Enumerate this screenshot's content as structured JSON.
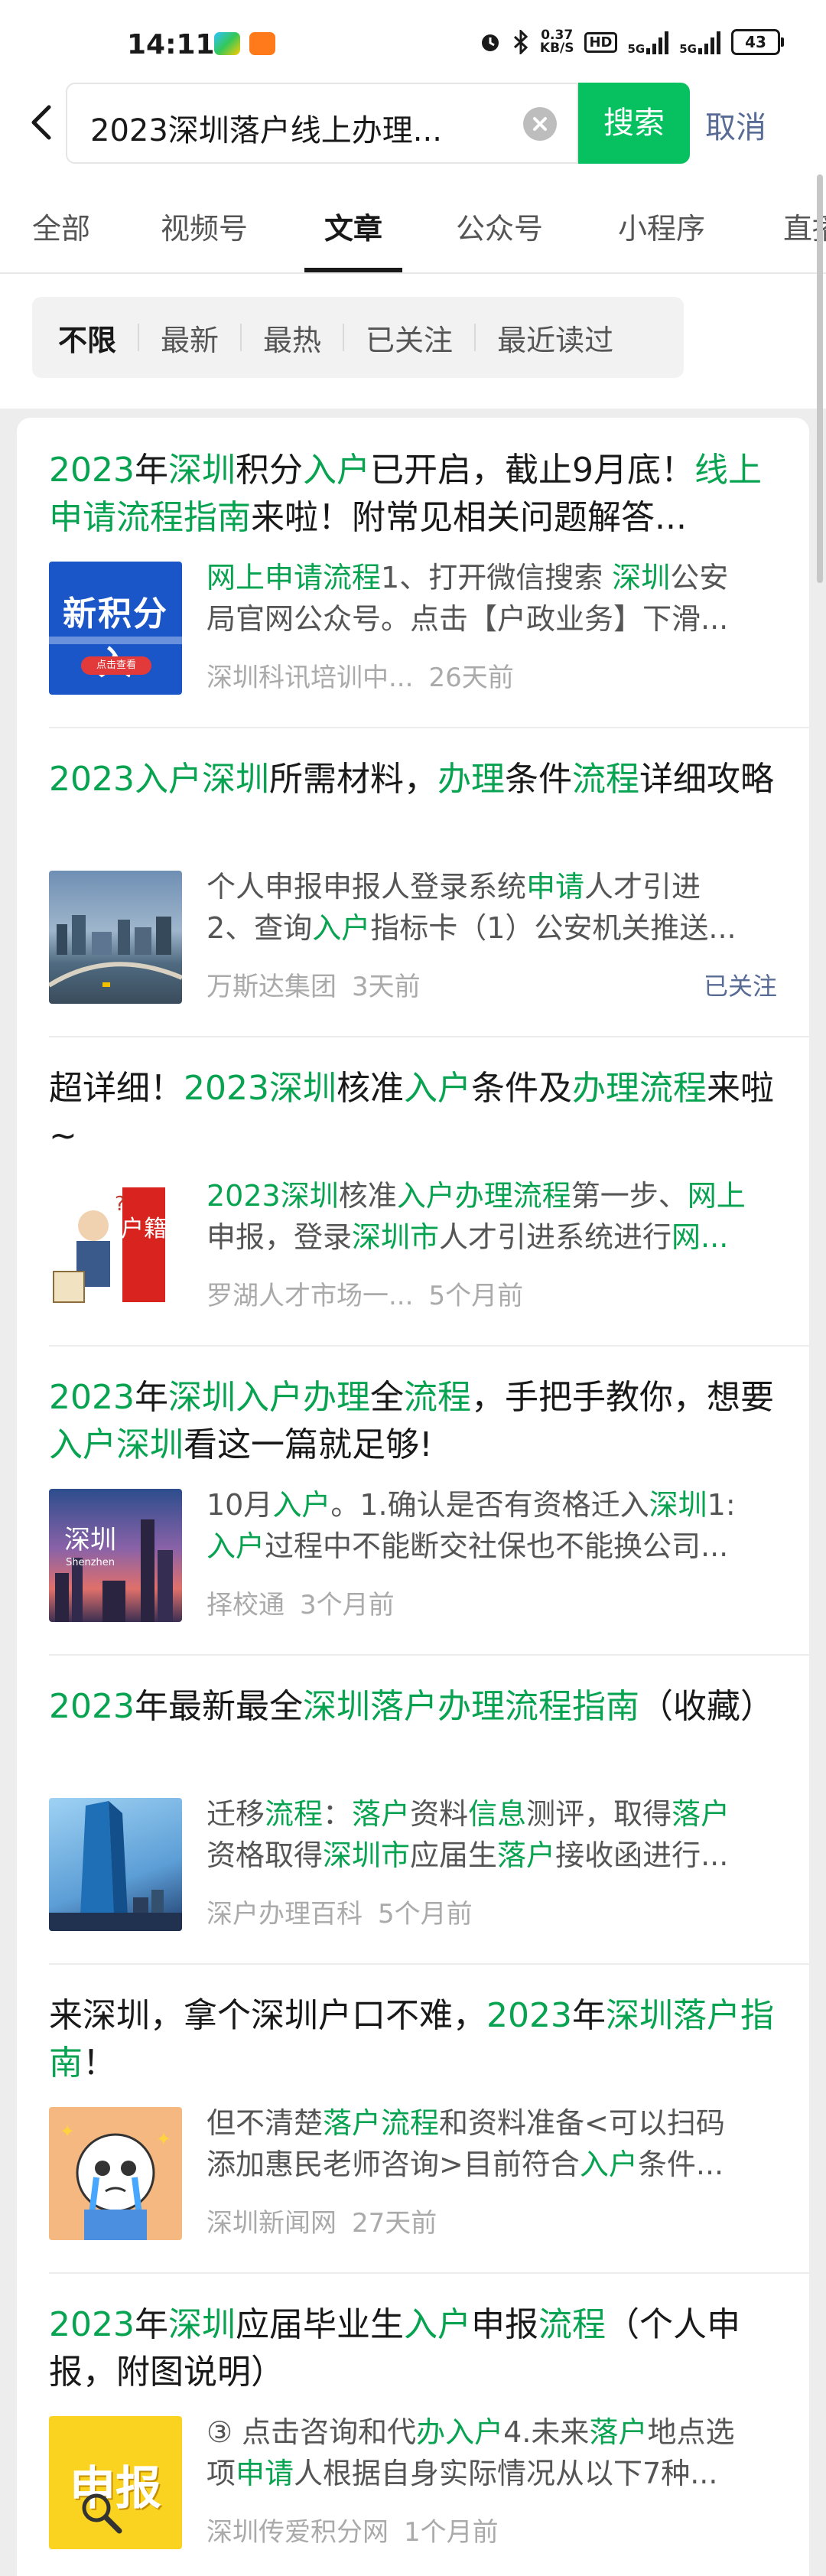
{
  "status": {
    "time": "14:11",
    "net_speed_value": "0.37",
    "net_speed_unit": "KB/S",
    "hd": "HD",
    "net1": "5G",
    "net2": "5G",
    "battery": "43"
  },
  "search": {
    "query": "2023深圳落户线上办理...",
    "search_button": "搜索",
    "cancel": "取消"
  },
  "tabs": [
    "全部",
    "视频号",
    "文章",
    "公众号",
    "小程序",
    "直播"
  ],
  "active_tab": "文章",
  "filters": [
    "不限",
    "最新",
    "最热",
    "已关注",
    "最近读过"
  ],
  "active_filter": "不限",
  "articles": [
    {
      "title_segments": [
        [
          "2023",
          1
        ],
        [
          "年",
          0
        ],
        [
          "深圳",
          1
        ],
        [
          "积分",
          0
        ],
        [
          "入户",
          1
        ],
        [
          "已开启，截止9月底！",
          0
        ],
        [
          "线上申请流程指南",
          1
        ],
        [
          "来啦！附常见相关问题解答...",
          0
        ]
      ],
      "snippet_lines": [
        [
          [
            "网上申请流程",
            1
          ],
          [
            "1、打开微信搜索 ",
            0
          ],
          [
            "深圳",
            1
          ],
          [
            "公安",
            0
          ]
        ],
        [
          [
            "局官网公众号。点击【户政业务】下滑...",
            0
          ]
        ]
      ],
      "source": "深圳科讯培训中...",
      "age": "26天前",
      "followed": "",
      "thumb_text": "新积分入",
      "thumb_badge": "点击查看"
    },
    {
      "title_segments": [
        [
          "2023",
          1
        ],
        [
          "入户",
          1
        ],
        [
          "深圳",
          1
        ],
        [
          "所需材料，",
          0
        ],
        [
          "办理",
          1
        ],
        [
          "条件",
          0
        ],
        [
          "流程",
          1
        ],
        [
          "详细攻略",
          0
        ]
      ],
      "snippet_lines": [
        [
          [
            "个人申报申报人登录系统",
            0
          ],
          [
            "申请",
            1
          ],
          [
            "人才引进",
            0
          ]
        ],
        [
          [
            "2、查询",
            0
          ],
          [
            "入户",
            1
          ],
          [
            "指标卡（1）公安机关推送...",
            0
          ]
        ]
      ],
      "source": "万斯达集团",
      "age": "3天前",
      "followed": "已关注",
      "thumb_text": "",
      "thumb_badge": ""
    },
    {
      "title_segments": [
        [
          "超详细！",
          0
        ],
        [
          "2023",
          1
        ],
        [
          "深圳",
          1
        ],
        [
          "核准",
          0
        ],
        [
          "入户",
          1
        ],
        [
          "条件及",
          0
        ],
        [
          "办理流程",
          1
        ],
        [
          "来啦~",
          0
        ]
      ],
      "snippet_lines": [
        [
          [
            "2023",
            1
          ],
          [
            "深圳",
            1
          ],
          [
            "核准",
            0
          ],
          [
            "入户办理流程",
            1
          ],
          [
            "第一步、",
            0
          ],
          [
            "网上",
            1
          ]
        ],
        [
          [
            "申报，登录",
            0
          ],
          [
            "深圳市",
            1
          ],
          [
            "人才引进系统进行",
            0
          ],
          [
            "网...",
            1
          ]
        ]
      ],
      "source": "罗湖人才市场一...",
      "age": "5个月前",
      "followed": "",
      "thumb_text": "户籍",
      "thumb_badge": ""
    },
    {
      "title_segments": [
        [
          "2023",
          1
        ],
        [
          "年",
          0
        ],
        [
          "深圳入户办理",
          1
        ],
        [
          "全",
          0
        ],
        [
          "流程",
          1
        ],
        [
          "，手把手教你，想要",
          0
        ],
        [
          "入户深圳",
          1
        ],
        [
          "看这一篇就足够!",
          0
        ]
      ],
      "snippet_lines": [
        [
          [
            "10月",
            0
          ],
          [
            "入户",
            1
          ],
          [
            "。1.确认是否有资格迁入",
            0
          ],
          [
            "深圳",
            1
          ],
          [
            "1:",
            0
          ]
        ],
        [
          [
            "入户",
            1
          ],
          [
            "过程中不能断交社保也不能换公司...",
            0
          ]
        ]
      ],
      "source": "择校通",
      "age": "3个月前",
      "followed": "",
      "thumb_text": "深圳",
      "thumb_badge": "Shenzhen"
    },
    {
      "title_segments": [
        [
          "2023",
          1
        ],
        [
          "年最新最全",
          0
        ],
        [
          "深圳落户办理流程指南",
          1
        ],
        [
          "（收藏）",
          0
        ]
      ],
      "snippet_lines": [
        [
          [
            "迁移",
            0
          ],
          [
            "流程",
            1
          ],
          [
            "：",
            0
          ],
          [
            "落户",
            1
          ],
          [
            "资料",
            0
          ],
          [
            "信息",
            1
          ],
          [
            "测评，取得",
            0
          ],
          [
            "落户",
            1
          ]
        ],
        [
          [
            "资格取得",
            0
          ],
          [
            "深圳市",
            1
          ],
          [
            "应届生",
            0
          ],
          [
            "落户",
            1
          ],
          [
            "接收函进行...",
            0
          ]
        ]
      ],
      "source": "深户办理百科",
      "age": "5个月前",
      "followed": "",
      "thumb_text": "",
      "thumb_badge": ""
    },
    {
      "title_segments": [
        [
          "来深圳，拿个深圳户口不难，",
          0
        ],
        [
          "2023",
          1
        ],
        [
          "年",
          0
        ],
        [
          "深圳落户指南",
          1
        ],
        [
          "！",
          0
        ]
      ],
      "snippet_lines": [
        [
          [
            "但不清楚",
            0
          ],
          [
            "落户流程",
            1
          ],
          [
            "和资料准备<可以扫码",
            0
          ]
        ],
        [
          [
            "添加惠民老师咨询>目前符合",
            0
          ],
          [
            "入户",
            1
          ],
          [
            "条件...",
            0
          ]
        ]
      ],
      "source": "深圳新闻网",
      "age": "27天前",
      "followed": "",
      "thumb_text": "",
      "thumb_badge": ""
    },
    {
      "title_segments": [
        [
          "2023",
          1
        ],
        [
          "年",
          0
        ],
        [
          "深圳",
          1
        ],
        [
          "应届毕业生",
          0
        ],
        [
          "入户",
          1
        ],
        [
          "申报",
          0
        ],
        [
          "流程",
          1
        ],
        [
          "（个人申报，附图说明）",
          0
        ]
      ],
      "snippet_lines": [
        [
          [
            "③ 点击咨询和代",
            0
          ],
          [
            "办入户",
            1
          ],
          [
            "4.未来",
            0
          ],
          [
            "落户",
            1
          ],
          [
            "地点选",
            0
          ]
        ],
        [
          [
            "项",
            0
          ],
          [
            "申请",
            1
          ],
          [
            "人根据自身实际情况从以下7种...",
            0
          ]
        ]
      ],
      "source": "深圳传爱积分网",
      "age": "1个月前",
      "followed": "",
      "thumb_text": "申报",
      "thumb_badge": ""
    }
  ]
}
